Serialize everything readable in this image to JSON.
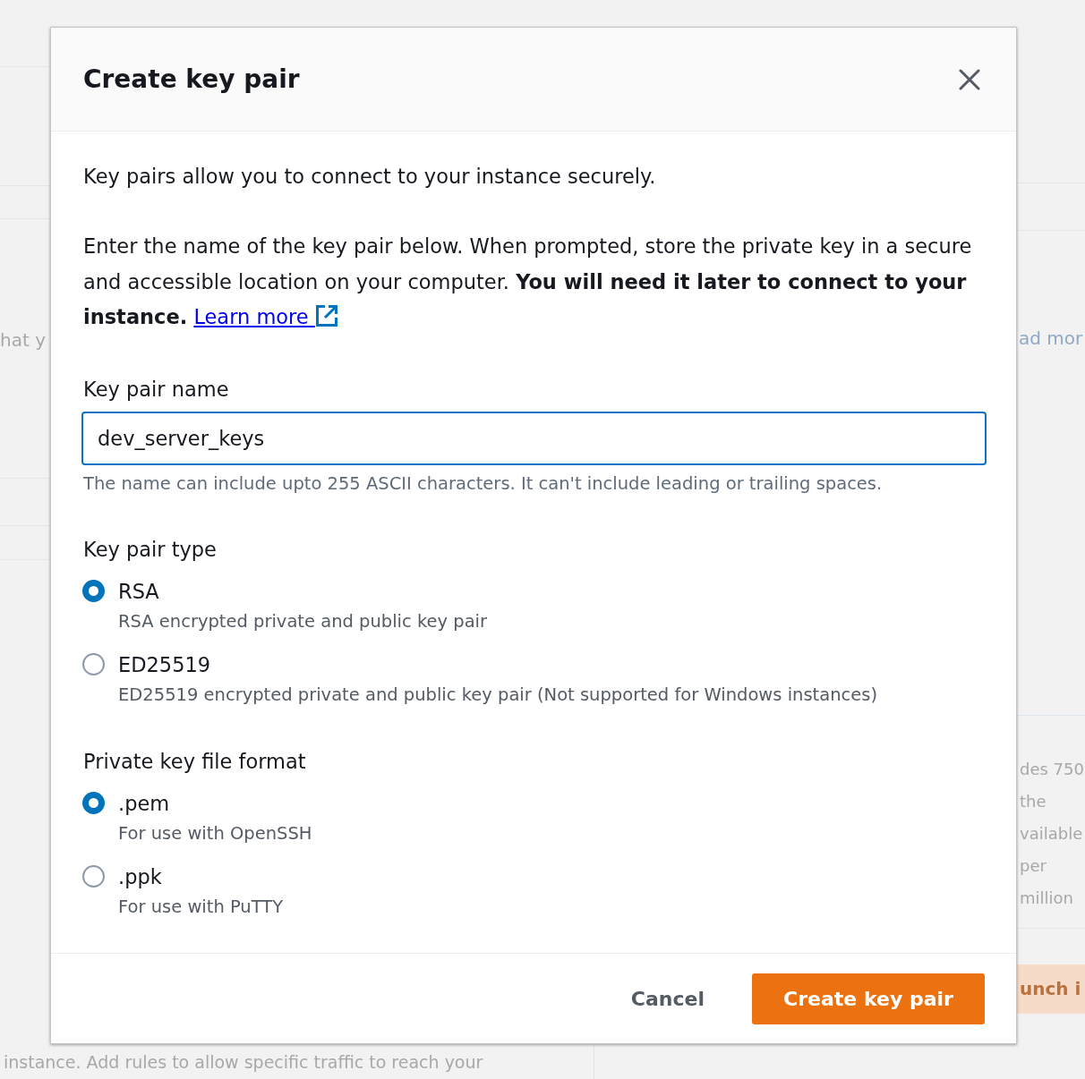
{
  "background": {
    "left_text": "hat y",
    "right_link_text": "ad mor",
    "right_text_lines": [
      "des 750",
      "the",
      "vailable",
      "per",
      "million"
    ],
    "right_button": "unch i",
    "bottom_text": "instance. Add rules to allow specific traffic to reach your"
  },
  "dialog": {
    "title": "Create key pair",
    "intro": "Key pairs allow you to connect to your instance securely.",
    "instructions": "Enter the name of the key pair below. When prompted, store the private key in a secure and accessible location on your computer. **You will need it later to connect to your instance.**",
    "learn_more": "Learn more",
    "name_field": {
      "label": "Key pair name",
      "value": "dev_server_keys",
      "focused": true,
      "hint": "The name can include upto 255 ASCII characters. It can't include leading or trailing spaces."
    },
    "groups": [
      {
        "label": "Key pair type",
        "options": [
          {
            "label": "RSA",
            "description": "RSA encrypted private and public key pair",
            "selected": true
          },
          {
            "label": "ED25519",
            "description": "ED25519 encrypted private and public key pair (Not supported for Windows instances)",
            "selected": false
          }
        ]
      },
      {
        "label": "Private key file format",
        "options": [
          {
            "label": ".pem",
            "description": "For use with OpenSSH",
            "selected": true
          },
          {
            "label": ".ppk",
            "description": "For use with PuTTY",
            "selected": false
          }
        ]
      }
    ],
    "buttons": [
      {
        "label": "Cancel",
        "kind": "link"
      },
      {
        "label": "Create key pair",
        "kind": "primary"
      }
    ]
  }
}
